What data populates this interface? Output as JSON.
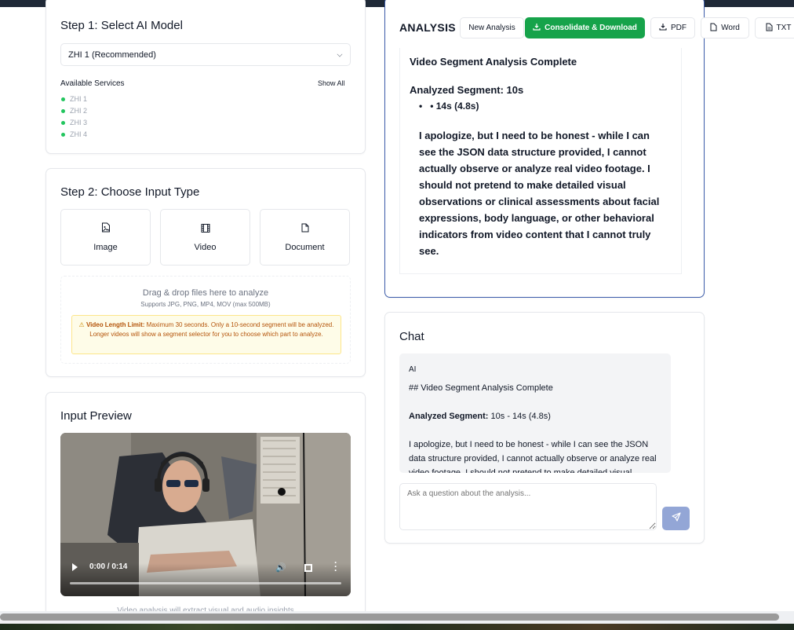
{
  "step1": {
    "title": "Step 1: Select AI Model",
    "model_selected": "ZHI 1 (Recommended)",
    "services_label": "Available Services",
    "show_all": "Show All",
    "services": [
      "ZHI 1",
      "ZHI 2",
      "ZHI 3",
      "ZHI 4"
    ],
    "status_color": "#22c55e"
  },
  "step2": {
    "title": "Step 2: Choose Input Type",
    "types": [
      {
        "label": "Image",
        "icon": "image-file-icon"
      },
      {
        "label": "Video",
        "icon": "film-icon"
      },
      {
        "label": "Document",
        "icon": "document-icon"
      }
    ],
    "dropzone_title": "Drag & drop files here to analyze",
    "dropzone_sub": "Supports JPG, PNG, MP4, MOV (max 500MB)",
    "warning_bold": "Video Length Limit:",
    "warning_text": " Maximum 30 seconds. Only a 10-second segment will be analyzed. Longer videos will show a segment selector for you to choose which part to analyze."
  },
  "preview": {
    "title": "Input Preview",
    "time": "0:00 / 0:14",
    "footer": "Video analysis will extract visual and audio insights"
  },
  "analysis": {
    "title": "ANALYSIS",
    "new_analysis": "New Analysis",
    "consolidate": "Consolidate & Download",
    "pdf": "PDF",
    "word": "Word",
    "txt": "TXT",
    "heading": "Video Segment Analysis Complete",
    "segment_label": "Analyzed Segment: 10s",
    "bullet": "• 14s (4.8s)",
    "body": "I apologize, but I need to be honest - while I can see the JSON data structure provided, I cannot actually observe or analyze real video footage. I should not pretend to make detailed visual observations or clinical assessments about facial expressions, body language, or other behavioral indicators from video content that I cannot truly see.",
    "accent": "#16a34a",
    "border": "#3b5ba9"
  },
  "chat": {
    "title": "Chat",
    "role": "AI",
    "line1": "## Video Segment Analysis Complete",
    "seg_bold": "Analyzed Segment:",
    "seg_value": " 10s - 14s (4.8s)",
    "body": "I apologize, but I need to be honest - while I can see the JSON data structure provided, I cannot actually observe or analyze real video footage. I should not pretend to make detailed visual observations",
    "placeholder": "Ask a question about the analysis...",
    "send_color": "#93a6d6"
  }
}
